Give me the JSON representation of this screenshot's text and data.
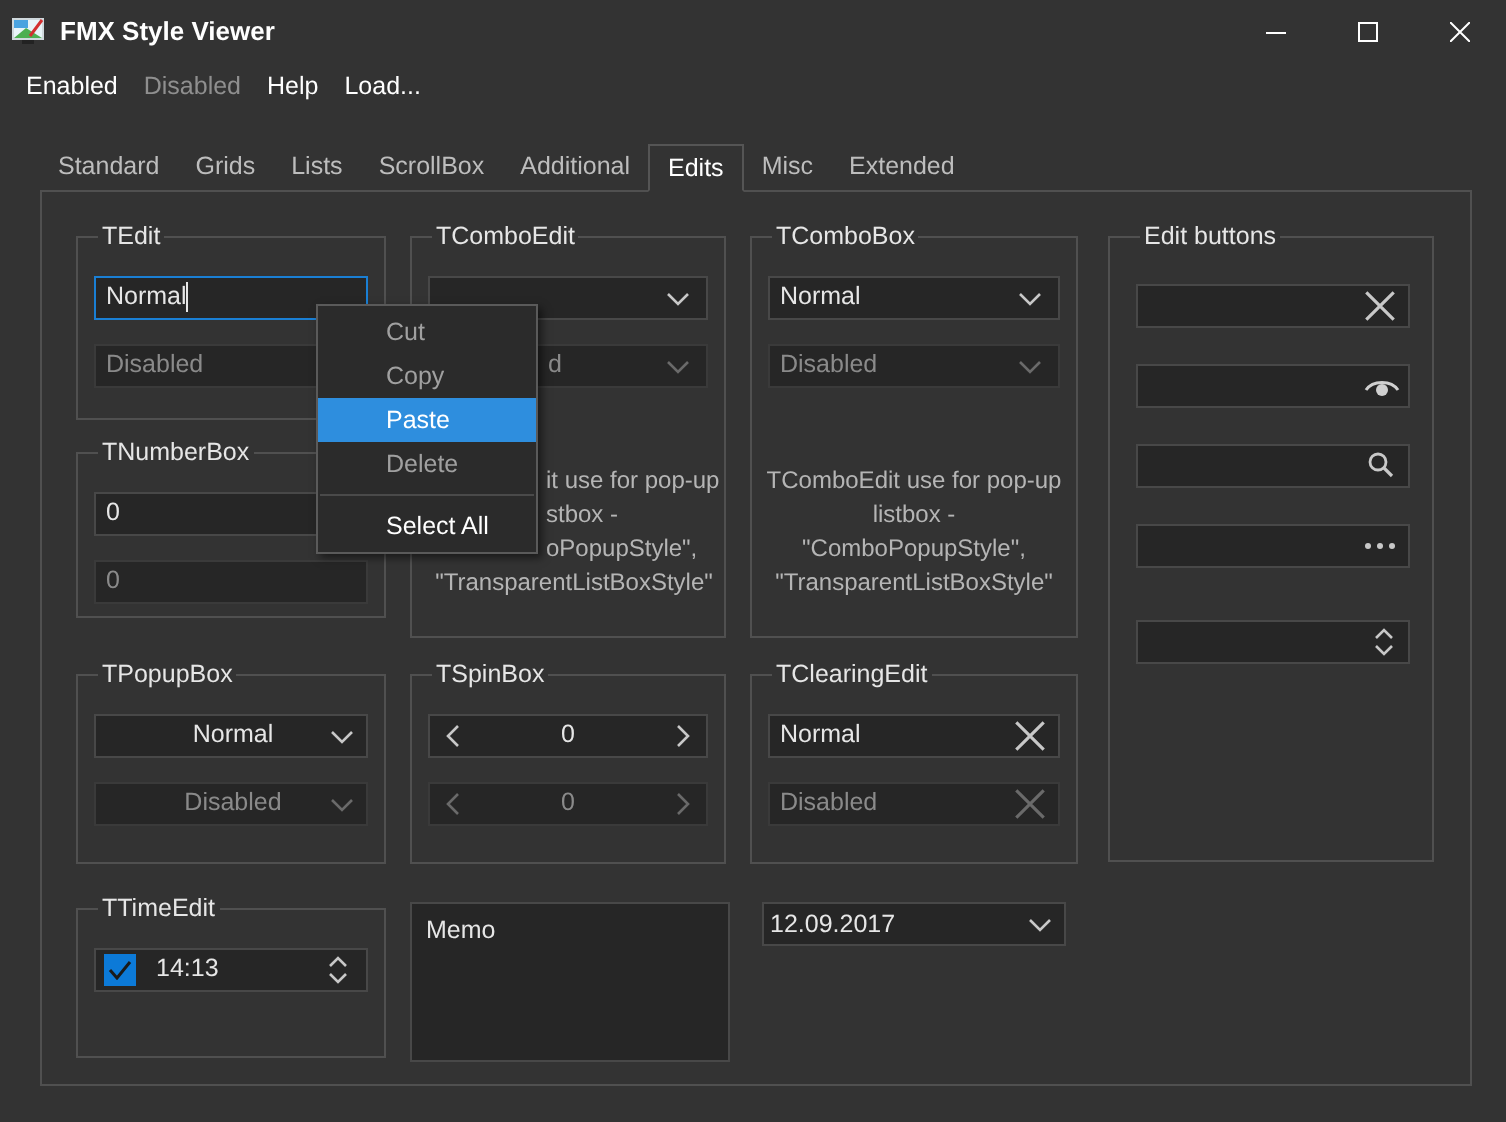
{
  "window": {
    "title": "FMX Style Viewer"
  },
  "menu": [
    {
      "label": "Enabled",
      "disabled": false
    },
    {
      "label": "Disabled",
      "disabled": true
    },
    {
      "label": "Help",
      "disabled": false
    },
    {
      "label": "Load...",
      "disabled": false
    }
  ],
  "tabs": [
    {
      "label": "Standard",
      "selected": false
    },
    {
      "label": "Grids",
      "selected": false
    },
    {
      "label": "Lists",
      "selected": false
    },
    {
      "label": "ScrollBox",
      "selected": false
    },
    {
      "label": "Additional",
      "selected": false
    },
    {
      "label": "Edits",
      "selected": true
    },
    {
      "label": "Misc",
      "selected": false
    },
    {
      "label": "Extended",
      "selected": false
    }
  ],
  "tedit": {
    "title": "TEdit",
    "fields": [
      {
        "kind": "edit",
        "value": "Normal",
        "focused": true,
        "disabled": false
      },
      {
        "kind": "edit",
        "value": "Disabled",
        "focused": false,
        "disabled": true
      }
    ]
  },
  "tnumberbox": {
    "title": "TNumberBox",
    "fields": [
      {
        "kind": "edit",
        "value": "0",
        "focused": false,
        "disabled": false
      },
      {
        "kind": "edit",
        "value": "0",
        "focused": false,
        "disabled": true
      }
    ]
  },
  "tcomboedit": {
    "title": "TComboEdit",
    "fields": [
      {
        "kind": "combo",
        "disabled": false
      },
      {
        "kind": "combo",
        "value": "d",
        "disabled": true
      }
    ],
    "note": [
      "it use for pop-up",
      "stbox -",
      "oPopupStyle\",",
      "\"TransparentListBoxStyle\""
    ]
  },
  "tcombobox": {
    "title": "TComboBox",
    "fields": [
      {
        "kind": "combo",
        "value": "Normal",
        "disabled": false
      },
      {
        "kind": "combo",
        "value": "Disabled",
        "disabled": true
      }
    ],
    "note": [
      "TComboEdit use for pop-up",
      "listbox -",
      "\"ComboPopupStyle\",",
      "\"TransparentListBoxStyle\""
    ]
  },
  "edit_buttons": {
    "title": "Edit buttons",
    "fields": [
      {
        "kind": "clear_edit",
        "disabled": false
      },
      {
        "kind": "password_edit",
        "disabled": false
      },
      {
        "kind": "search_edit",
        "disabled": false
      },
      {
        "kind": "ellipsis_edit",
        "disabled": false
      },
      {
        "kind": "spin_edit",
        "disabled": false
      }
    ]
  },
  "tpopupbox": {
    "title": "TPopupBox",
    "fields": [
      {
        "kind": "popup",
        "value": "Normal",
        "disabled": false
      },
      {
        "kind": "popup",
        "value": "Disabled",
        "disabled": true
      }
    ]
  },
  "tspinbox": {
    "title": "TSpinBox",
    "fields": [
      {
        "kind": "spin",
        "value": "0",
        "disabled": false
      },
      {
        "kind": "spin",
        "value": "0",
        "disabled": true
      }
    ]
  },
  "tclearingedit": {
    "title": "TClearingEdit",
    "fields": [
      {
        "kind": "clear_edit",
        "value": "Normal",
        "disabled": false
      },
      {
        "kind": "clear_edit",
        "value": "Disabled",
        "disabled": true
      }
    ]
  },
  "ttimeedit": {
    "title": "TTimeEdit",
    "fields": [
      {
        "kind": "time",
        "value": "14:13",
        "checked": true,
        "disabled": false
      }
    ]
  },
  "memo": {
    "value": "Memo"
  },
  "date": {
    "value": "12.09.2017"
  },
  "context_menu": [
    {
      "label": "Cut",
      "disabled": true,
      "selected": false
    },
    {
      "label": "Copy",
      "disabled": true,
      "selected": false
    },
    {
      "label": "Paste",
      "disabled": false,
      "selected": true
    },
    {
      "label": "Delete",
      "disabled": true,
      "selected": false
    },
    {
      "kind": "separator"
    },
    {
      "label": "Select All",
      "disabled": false,
      "selected": false
    }
  ]
}
